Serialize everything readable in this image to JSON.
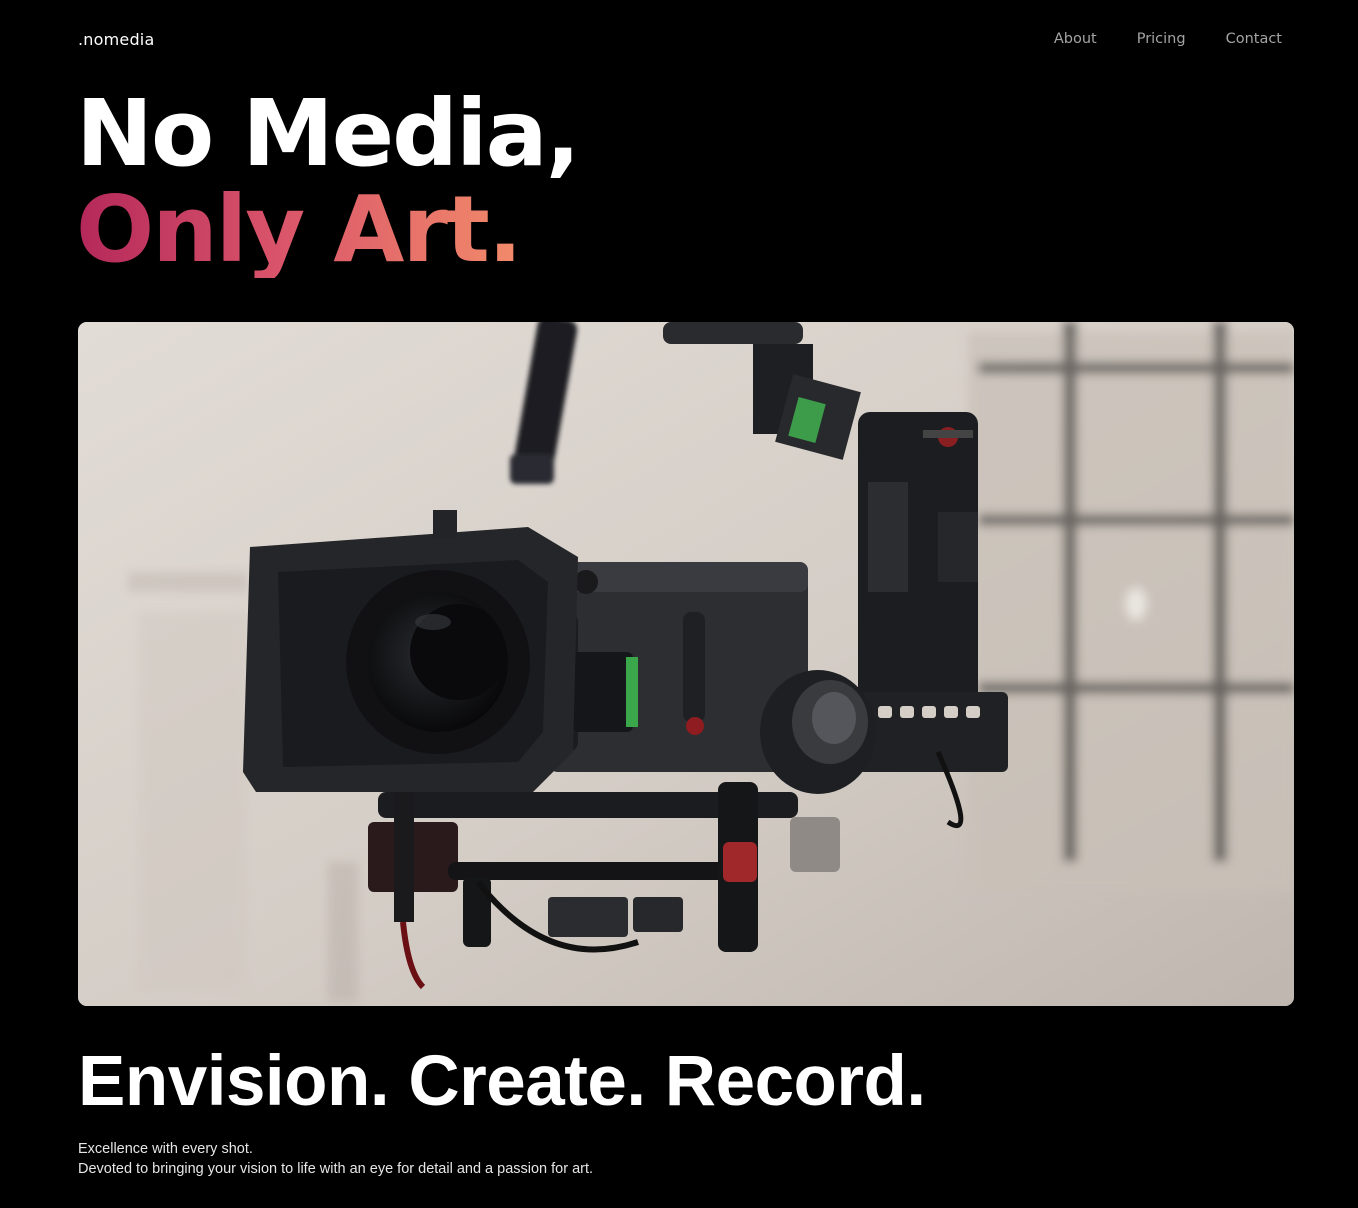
{
  "nav": {
    "logo": ".nomedia",
    "links": [
      {
        "label": "About"
      },
      {
        "label": "Pricing"
      },
      {
        "label": "Contact"
      }
    ]
  },
  "hero": {
    "headline_line1": "No Media,",
    "headline_line2": "Only Art.",
    "gradient_colors": [
      "#b4285a",
      "#d9546a",
      "#f28b6a"
    ],
    "image_subject": "cinema-camera-on-gimbal-photo"
  },
  "section": {
    "tagline": "Envision. Create. Record.",
    "desc_line1": "Excellence with every shot.",
    "desc_line2": "Devoted to bringing your vision to life with an eye for detail and a passion for art."
  }
}
